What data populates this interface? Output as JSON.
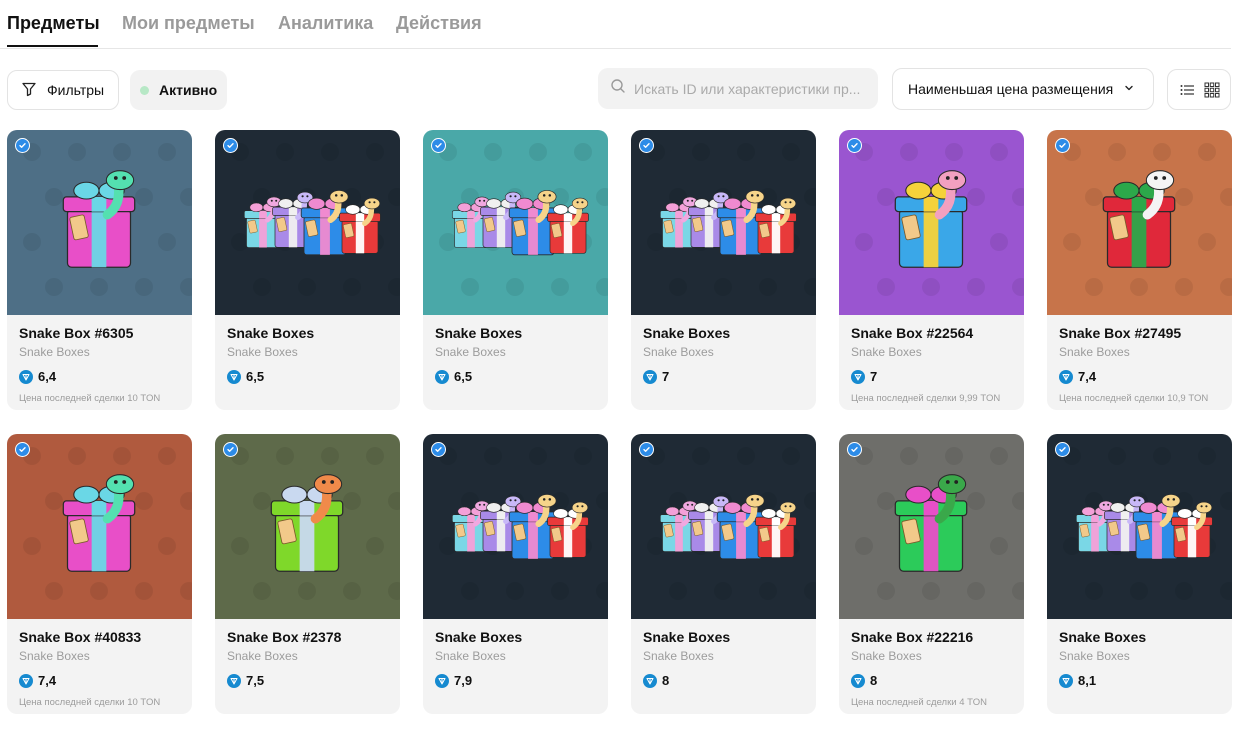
{
  "tabs": [
    {
      "label": "Предметы",
      "active": true
    },
    {
      "label": "Мои предметы",
      "active": false
    },
    {
      "label": "Аналитика",
      "active": false
    },
    {
      "label": "Действия",
      "active": false
    }
  ],
  "toolbar": {
    "filters_label": "Фильтры",
    "status_label": "Активно",
    "status_color": "#b7e8c6",
    "search_placeholder": "Искать ID или характеристики пр...",
    "sort_label": "Наименьшая цена размещения",
    "views": [
      "list-icon",
      "grid-icon"
    ],
    "active_view": "grid"
  },
  "currency_icon": "ton-icon",
  "items": [
    {
      "title": "Snake Box #6305",
      "collection": "Snake Boxes",
      "price": "6,4",
      "last_deal": "Цена последней сделки 10 TON",
      "bg": "#4e6f86",
      "kind": "single",
      "box": "#e84fc8",
      "ribbon": "#6ad7e6",
      "snake": "#54e0b0"
    },
    {
      "title": "Snake Boxes",
      "collection": "Snake Boxes",
      "price": "6,5",
      "last_deal": "",
      "bg": "#1f2a35",
      "kind": "bundle"
    },
    {
      "title": "Snake Boxes",
      "collection": "Snake Boxes",
      "price": "6,5",
      "last_deal": "",
      "bg": "#4aa8a8",
      "kind": "bundle"
    },
    {
      "title": "Snake Boxes",
      "collection": "Snake Boxes",
      "price": "7",
      "last_deal": "",
      "bg": "#1f2a35",
      "kind": "bundle"
    },
    {
      "title": "Snake Box #22564",
      "collection": "Snake Boxes",
      "price": "7",
      "last_deal": "Цена последней сделки 9,99 TON",
      "bg": "#9a55d0",
      "kind": "single",
      "box": "#3aa7e8",
      "ribbon": "#f5d23a",
      "snake": "#f2a0c0"
    },
    {
      "title": "Snake Box #27495",
      "collection": "Snake Boxes",
      "price": "7,4",
      "last_deal": "Цена последней сделки 10,9 TON",
      "bg": "#c7744a",
      "kind": "single",
      "box": "#e0283a",
      "ribbon": "#2ca84a",
      "snake": "#f4f4f4"
    },
    {
      "title": "Snake Box #40833",
      "collection": "Snake Boxes",
      "price": "7,4",
      "last_deal": "Цена последней сделки 10 TON",
      "bg": "#b05a3e",
      "kind": "single",
      "box": "#e84fc8",
      "ribbon": "#6ad7e6",
      "snake": "#54e0b0"
    },
    {
      "title": "Snake Box #2378",
      "collection": "Snake Boxes",
      "price": "7,5",
      "last_deal": "",
      "bg": "#5e6a4a",
      "kind": "single",
      "box": "#7fd82a",
      "ribbon": "#c9d9f0",
      "snake": "#f08a4a"
    },
    {
      "title": "Snake Boxes",
      "collection": "Snake Boxes",
      "price": "7,9",
      "last_deal": "",
      "bg": "#1f2a35",
      "kind": "bundle"
    },
    {
      "title": "Snake Boxes",
      "collection": "Snake Boxes",
      "price": "8",
      "last_deal": "",
      "bg": "#1f2a35",
      "kind": "bundle"
    },
    {
      "title": "Snake Box #22216",
      "collection": "Snake Boxes",
      "price": "8",
      "last_deal": "Цена последней сделки 4 TON",
      "bg": "#6e6e6a",
      "kind": "single",
      "box": "#2ccb5a",
      "ribbon": "#e84fc8",
      "snake": "#3aa84a"
    },
    {
      "title": "Snake Boxes",
      "collection": "Snake Boxes",
      "price": "8,1",
      "last_deal": "",
      "bg": "#1f2a35",
      "kind": "bundle"
    }
  ]
}
